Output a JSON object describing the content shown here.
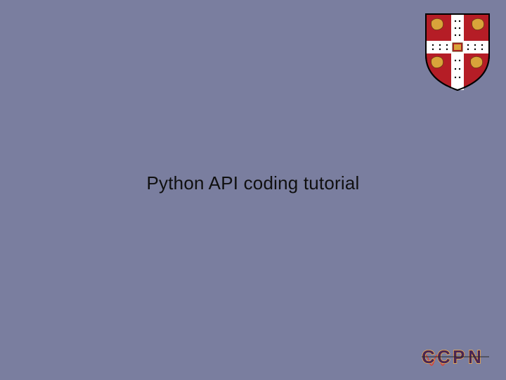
{
  "slide": {
    "title": "Python API coding tutorial"
  },
  "logos": {
    "top_right": "university-crest",
    "bottom_right": "ccpn-logo",
    "ccpn_text": "CCPN"
  },
  "colors": {
    "background": "#7a7e9f",
    "text": "#101010",
    "crest_red": "#b51d26",
    "crest_gold": "#d9a43a",
    "ccpn_outline": "#ffb347",
    "ccpn_fill": "#4a2654"
  }
}
